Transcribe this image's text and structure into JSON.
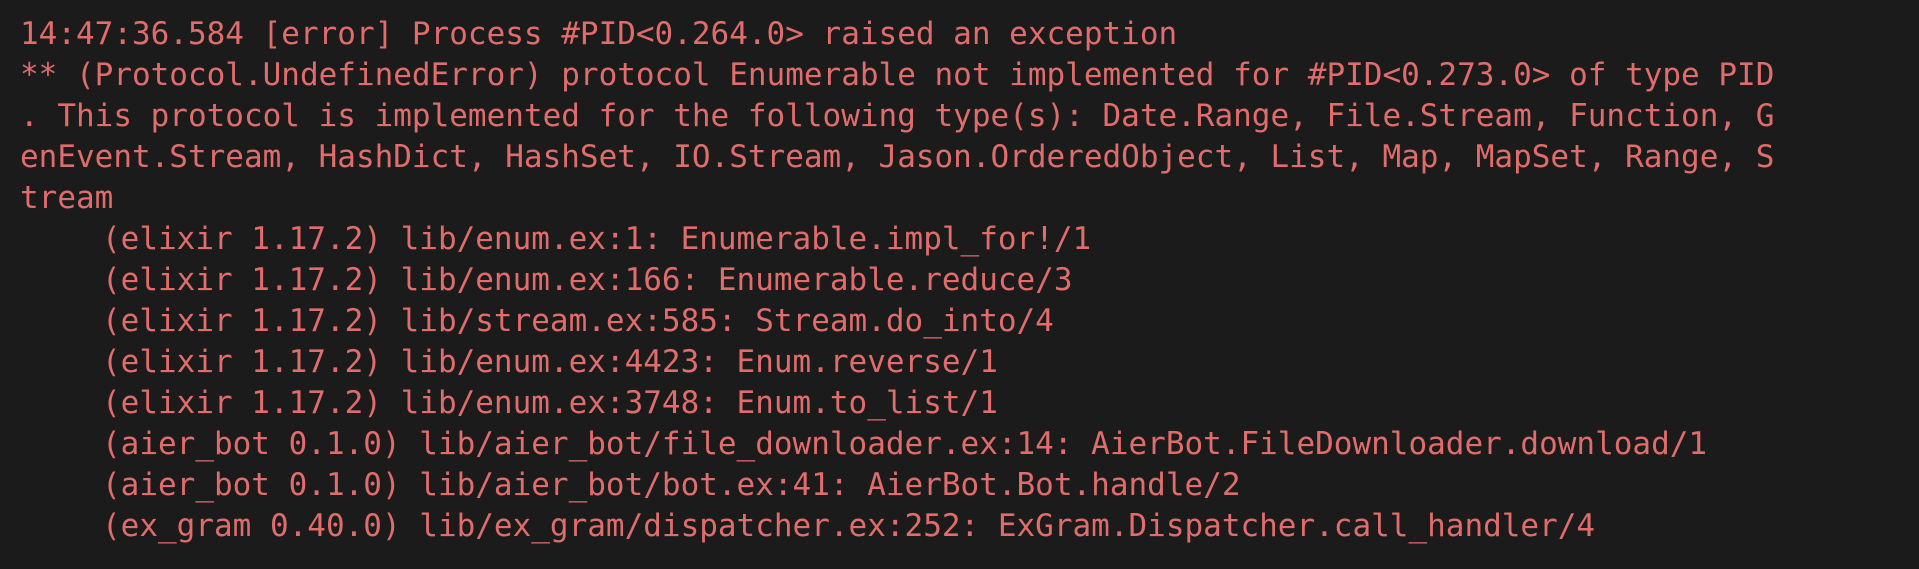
{
  "terminal": {
    "colors": {
      "background": "#1b1b1b",
      "error_text": "#e06c6c"
    },
    "header_lines": [
      "14:47:36.584 [error] Process #PID<0.264.0> raised an exception",
      "** (Protocol.UndefinedError) protocol Enumerable not implemented for #PID<0.273.0> of type PID",
      ". This protocol is implemented for the following type(s): Date.Range, File.Stream, Function, G",
      "enEvent.Stream, HashDict, HashSet, IO.Stream, Jason.OrderedObject, List, Map, MapSet, Range, S",
      "tream"
    ],
    "stacktrace": [
      "(elixir 1.17.2) lib/enum.ex:1: Enumerable.impl_for!/1",
      "(elixir 1.17.2) lib/enum.ex:166: Enumerable.reduce/3",
      "(elixir 1.17.2) lib/stream.ex:585: Stream.do_into/4",
      "(elixir 1.17.2) lib/enum.ex:4423: Enum.reverse/1",
      "(elixir 1.17.2) lib/enum.ex:3748: Enum.to_list/1",
      "(aier_bot 0.1.0) lib/aier_bot/file_downloader.ex:14: AierBot.FileDownloader.download/1",
      "(aier_bot 0.1.0) lib/aier_bot/bot.ex:41: AierBot.Bot.handle/2",
      "(ex_gram 0.40.0) lib/ex_gram/dispatcher.ex:252: ExGram.Dispatcher.call_handler/4"
    ]
  }
}
